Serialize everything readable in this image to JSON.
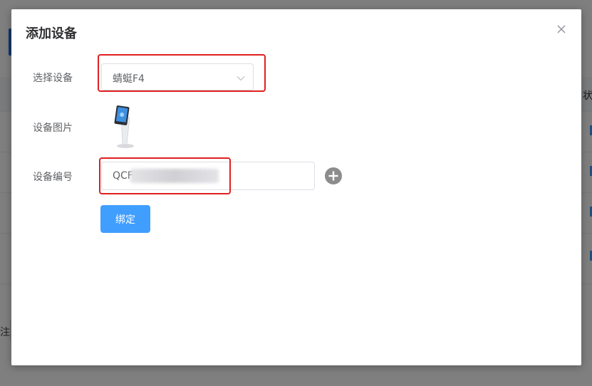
{
  "background": {
    "column_header": "状",
    "footer_text": "注"
  },
  "dialog": {
    "title": "添加设备",
    "close_icon": "close-icon",
    "fields": {
      "select_device": {
        "label": "选择设备",
        "value": "蜻蜓F4",
        "icon": "chevron-down-icon"
      },
      "device_image": {
        "label": "设备图片",
        "icon": "kiosk-device-image"
      },
      "device_number": {
        "label": "设备编号",
        "value": "QCF",
        "add_icon": "plus-circle-icon"
      }
    },
    "bind_button": "绑定"
  },
  "colors": {
    "primary": "#409eff",
    "highlight": "#e02020",
    "overlay": "rgba(0,0,0,0.5)"
  }
}
